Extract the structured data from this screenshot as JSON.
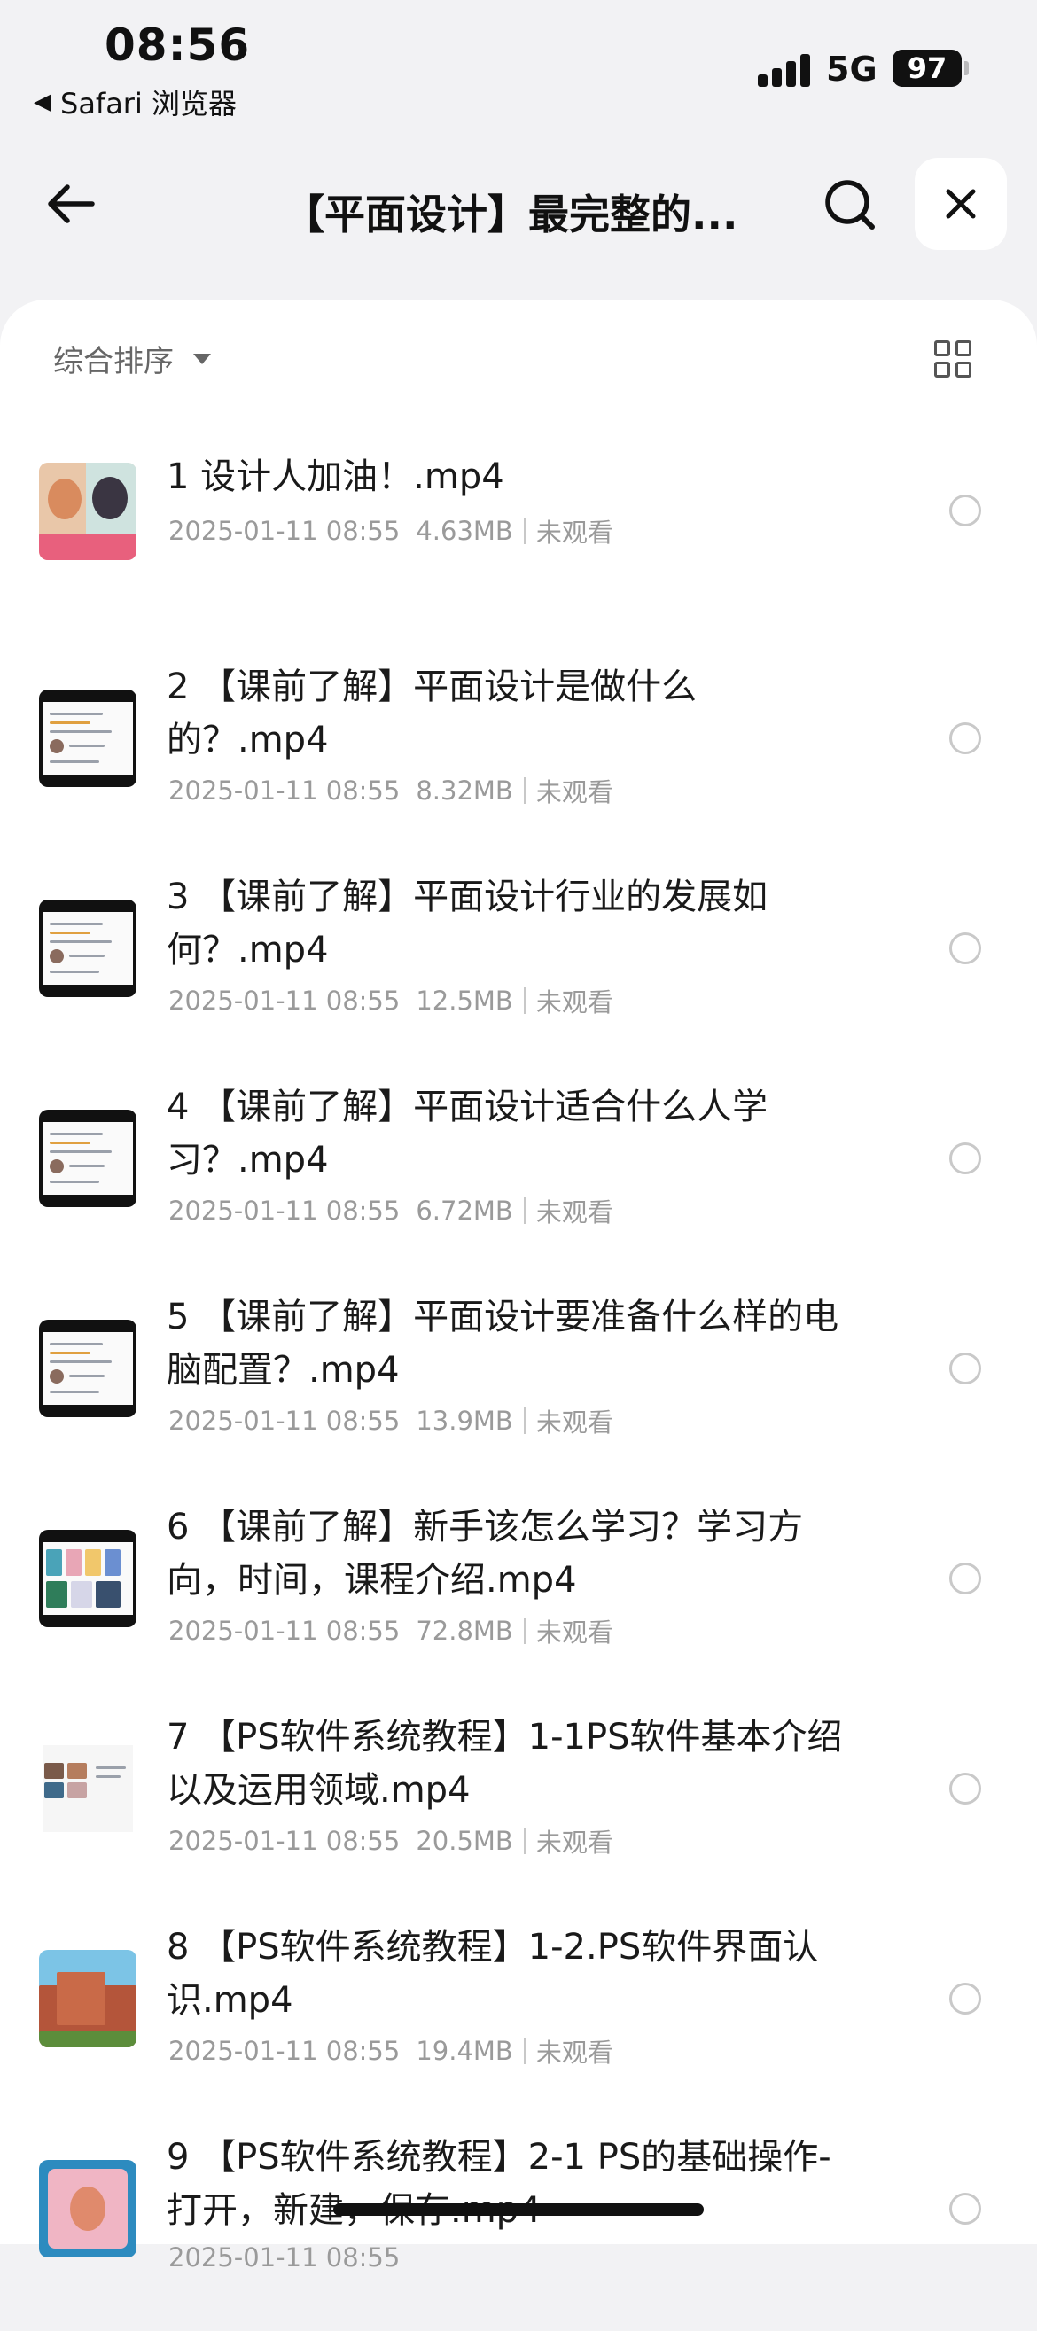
{
  "status_bar": {
    "time": "08:56",
    "back_app": "Safari 浏览器",
    "network": "5G",
    "battery": "97"
  },
  "nav": {
    "title": "【平面设计】最完整的...",
    "icons": [
      "back-arrow-icon",
      "search-icon",
      "close-icon"
    ]
  },
  "toolbar": {
    "sort_label": "综合排序",
    "view_icon": "grid-view-icon"
  },
  "files": [
    {
      "title": "1 设计人加油！.mp4",
      "date": "2025-01-11 08:55",
      "size": "4.63MB",
      "status": "未观看",
      "thumb": "anime"
    },
    {
      "title": "2 【课前了解】平面设计是做什么的？.mp4",
      "date": "2025-01-11 08:55",
      "size": "8.32MB",
      "status": "未观看",
      "thumb": "slide"
    },
    {
      "title": "3 【课前了解】平面设计行业的发展如何？.mp4",
      "date": "2025-01-11 08:55",
      "size": "12.5MB",
      "status": "未观看",
      "thumb": "slide"
    },
    {
      "title": "4 【课前了解】平面设计适合什么人学习？.mp4",
      "date": "2025-01-11 08:55",
      "size": "6.72MB",
      "status": "未观看",
      "thumb": "slide"
    },
    {
      "title": "5 【课前了解】平面设计要准备什么样的电脑配置？.mp4",
      "date": "2025-01-11 08:55",
      "size": "13.9MB",
      "status": "未观看",
      "thumb": "slide"
    },
    {
      "title": "6 【课前了解】新手该怎么学习？学习方向，时间，课程介绍.mp4",
      "date": "2025-01-11 08:55",
      "size": "72.8MB",
      "status": "未观看",
      "thumb": "collage"
    },
    {
      "title": "7 【PS软件系统教程】1-1PS软件基本介绍以及运用领域.mp4",
      "date": "2025-01-11 08:55",
      "size": "20.5MB",
      "status": "未观看",
      "thumb": "ps"
    },
    {
      "title": "8 【PS软件系统教程】1-2.PS软件界面认识.mp4",
      "date": "2025-01-11 08:55",
      "size": "19.4MB",
      "status": "未观看",
      "thumb": "landscape"
    },
    {
      "title": "9 【PS软件系统教程】2-1 PS的基础操作-打开，新建，保存.mp4",
      "date": "2025-01-11 08:55",
      "size": "",
      "status": "",
      "thumb": "portrait"
    }
  ]
}
